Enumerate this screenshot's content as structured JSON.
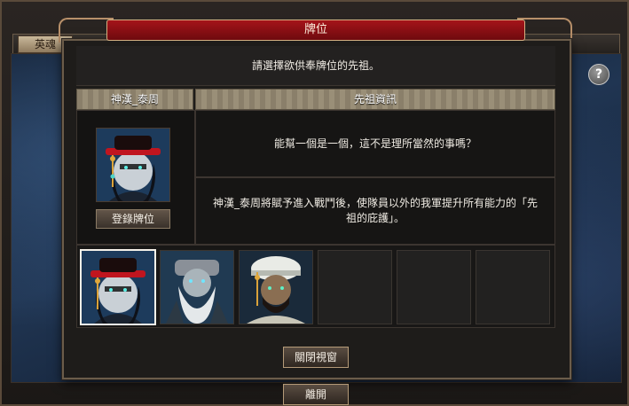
{
  "outer": {
    "tab_label": "英魂",
    "leave_label": "離開",
    "help_symbol": "?"
  },
  "dialog": {
    "title": "牌位",
    "prompt": "請選擇欲供奉牌位的先祖。",
    "left_header": "神漢_泰周",
    "right_header": "先祖資訊",
    "register_label": "登錄牌位",
    "quote": "能幫一個是一個，這不是理所當然的事嗎？",
    "description": "神漢_泰周將賦予進入戰鬥後，使隊員以外的我軍提升所有能力的「先祖的庇護」。",
    "close_label": "關閉視窗"
  },
  "ancestors": [
    {
      "icon": "ancestor-red-hat-portrait",
      "selected": true
    },
    {
      "icon": "ancestor-old-bearded-sage-portrait",
      "selected": false
    },
    {
      "icon": "ancestor-turbaned-warrior-portrait",
      "selected": false
    },
    {
      "icon": "empty-slot",
      "selected": false
    },
    {
      "icon": "empty-slot",
      "selected": false
    },
    {
      "icon": "empty-slot",
      "selected": false
    }
  ],
  "colors": {
    "title_red": "#a5141a",
    "frame_gold": "#b8906a"
  }
}
